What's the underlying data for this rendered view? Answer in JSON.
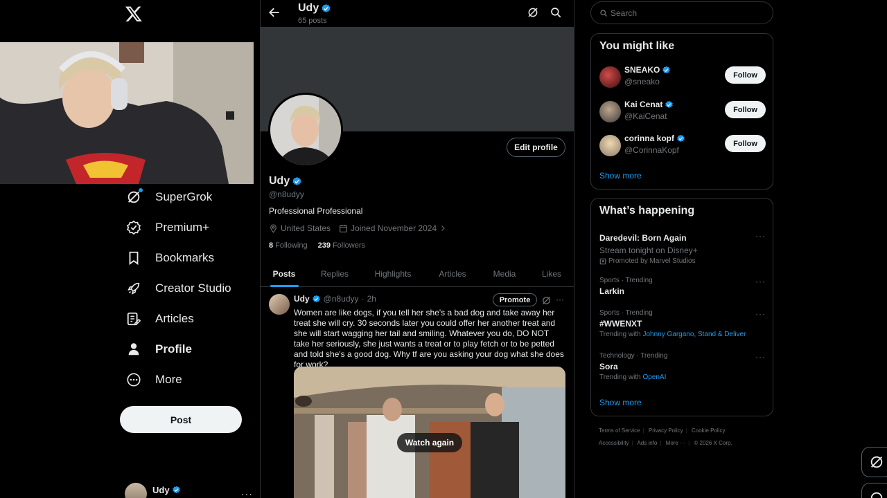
{
  "nav": {
    "items": [
      {
        "label": "SuperGrok",
        "icon": "supergrok-icon"
      },
      {
        "label": "Premium+",
        "icon": "premium-verified-icon"
      },
      {
        "label": "Bookmarks",
        "icon": "bookmark-icon"
      },
      {
        "label": "Creator Studio",
        "icon": "rocket-icon"
      },
      {
        "label": "Articles",
        "icon": "articles-icon"
      },
      {
        "label": "Profile",
        "icon": "person-icon"
      },
      {
        "label": "More",
        "icon": "more-circle-icon"
      }
    ],
    "post_label": "Post",
    "account": {
      "name": "Udy"
    }
  },
  "header": {
    "name": "Udy",
    "posts_count": "65 posts"
  },
  "profile": {
    "name": "Udy",
    "handle": "@n8udyy",
    "bio": "Professional Professional",
    "location": "United States",
    "joined": "Joined November 2024",
    "following_count": "8",
    "following_label": "Following",
    "followers_count": "239",
    "followers_label": "Followers",
    "edit_label": "Edit profile"
  },
  "tabs": [
    "Posts",
    "Replies",
    "Highlights",
    "Articles",
    "Media",
    "Likes"
  ],
  "tweet": {
    "name": "Udy",
    "handle": "@n8udyy",
    "time": "2h",
    "promote_label": "Promote",
    "text": "Women are like dogs, if you tell her she's a bad dog and take away her treat she will cry. 30 seconds later you could offer her another treat and she will start wagging her tail and smiling. Whatever you do, DO NOT take her seriously, she just wants a treat or to play fetch or to be petted and told she's a good dog. Why tf are you asking your dog what she does for work?",
    "watch_label": "Watch again"
  },
  "search": {
    "placeholder": "Search"
  },
  "suggestions": {
    "title": "You might like",
    "items": [
      {
        "name": "SNEAKO",
        "handle": "@sneako",
        "button": "Follow"
      },
      {
        "name": "Kai Cenat",
        "handle": "@KaiCenat",
        "button": "Follow"
      },
      {
        "name": "corinna kopf",
        "handle": "@CorinnaKopf",
        "button": "Follow"
      }
    ],
    "show_more": "Show more"
  },
  "happening": {
    "title": "What’s happening",
    "items": [
      {
        "title": "Daredevil: Born Again",
        "sub": "Stream tonight on Disney+",
        "promo": "Promoted by Marvel Studios"
      },
      {
        "context": "Sports · Trending",
        "title": "Larkin"
      },
      {
        "context": "Sports · Trending",
        "title": "#WWENXT",
        "trending_with": "Trending with",
        "links": "Johnny Gargano, Stand & Deliver"
      },
      {
        "context": "Technology · Trending",
        "title": "Sora",
        "trending_with": "Trending with",
        "links": "OpenAI"
      }
    ],
    "show_more": "Show more"
  },
  "footer": [
    "Terms of Service",
    "Privacy Policy",
    "Cookie Policy",
    "Accessibility",
    "Ads info",
    "More ···",
    "© 2026 X Corp."
  ],
  "colors": {
    "accent": "#1d9bf0",
    "background": "#000000",
    "border": "#2f3336",
    "muted": "#71767b"
  }
}
